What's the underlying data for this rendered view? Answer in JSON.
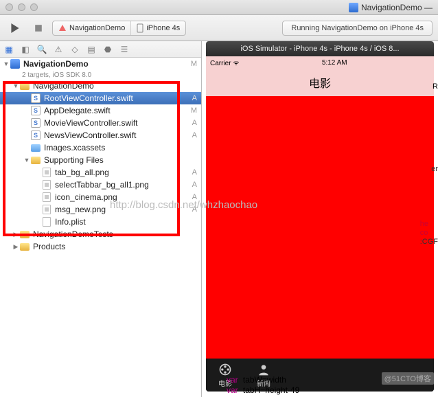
{
  "window": {
    "title": "NavigationDemo —"
  },
  "toolbar": {
    "scheme_app": "NavigationDemo",
    "scheme_dest": "iPhone 4s",
    "status": "Running NavigationDemo on iPhone 4s"
  },
  "navigator": {
    "root": {
      "name": "NavigationDemo",
      "sub": "2 targets, iOS SDK 8.0",
      "badge": "M"
    },
    "items": [
      {
        "indent": 1,
        "type": "folder-y",
        "disc": "▼",
        "name": "NavigationDemo",
        "badge": ""
      },
      {
        "indent": 2,
        "type": "swift",
        "name": "RootViewController.swift",
        "badge": "A",
        "selected": true
      },
      {
        "indent": 2,
        "type": "swift",
        "name": "AppDelegate.swift",
        "badge": "M"
      },
      {
        "indent": 2,
        "type": "swift",
        "name": "MovieViewController.swift",
        "badge": "A"
      },
      {
        "indent": 2,
        "type": "swift",
        "name": "NewsViewController.swift",
        "badge": "A"
      },
      {
        "indent": 2,
        "type": "asset",
        "name": "Images.xcassets",
        "badge": ""
      },
      {
        "indent": 2,
        "type": "folder-y",
        "disc": "▼",
        "name": "Supporting Files",
        "badge": ""
      },
      {
        "indent": 3,
        "type": "png",
        "name": "tab_bg_all.png",
        "badge": "A"
      },
      {
        "indent": 3,
        "type": "png",
        "name": "selectTabbar_bg_all1.png",
        "badge": "A"
      },
      {
        "indent": 3,
        "type": "png",
        "name": "icon_cinema.png",
        "badge": "A"
      },
      {
        "indent": 3,
        "type": "png",
        "name": "msg_new.png",
        "badge": "A"
      },
      {
        "indent": 3,
        "type": "plist",
        "name": "Info.plist",
        "badge": ""
      },
      {
        "indent": 1,
        "type": "folder-y",
        "disc": "▶",
        "name": "NavigationDemoTests",
        "badge": ""
      },
      {
        "indent": 1,
        "type": "folder-y",
        "disc": "▶",
        "name": "Products",
        "badge": ""
      }
    ]
  },
  "simulator": {
    "title": "iOS Simulator - iPhone 4s - iPhone 4s / iOS 8...",
    "carrier": "Carrier",
    "time": "5:12 AM",
    "nav_title": "电影",
    "tabs": [
      "电影",
      "新闻"
    ]
  },
  "code": {
    "frag1": "Roc",
    "frag2": "er",
    "he": "he",
    "co": "co",
    "cgf": ":CGF",
    "var": "var",
    "line1": "tabW=width",
    "line2": "tabH=height-49"
  },
  "watermark": "http://blog.csdn.net/whzhaochao",
  "ctomark": "@51CTO博客"
}
